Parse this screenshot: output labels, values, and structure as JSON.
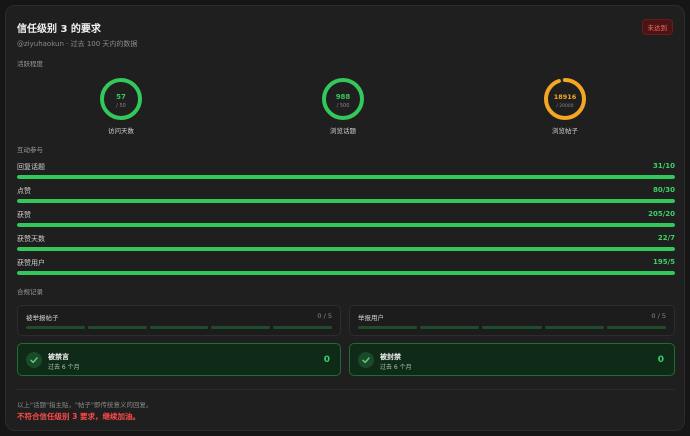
{
  "header": {
    "title": "信任级别 3 的要求",
    "badge": "未达到",
    "subtitle": "@ziyuhaokun · 过去 100 天内的数据"
  },
  "activity": {
    "section": "活跃程度",
    "rings": [
      {
        "value": "57",
        "total": "/ 50",
        "label": "访问天数",
        "progress": 1.0,
        "color": "#34c759"
      },
      {
        "value": "988",
        "total": "/ 500",
        "label": "浏览话题",
        "progress": 1.0,
        "color": "#34c759"
      },
      {
        "value": "18916",
        "total": "/ 20000",
        "label": "浏览帖子",
        "progress": 0.946,
        "color": "#f5a623"
      }
    ]
  },
  "interaction": {
    "section": "互动参与",
    "bars": [
      {
        "label": "回复话题",
        "value": "31/10",
        "progress": 1.0
      },
      {
        "label": "点赞",
        "value": "80/30",
        "progress": 1.0
      },
      {
        "label": "获赞",
        "value": "205/20",
        "progress": 1.0
      },
      {
        "label": "获赞天数",
        "value": "22/7",
        "progress": 1.0
      },
      {
        "label": "获赞用户",
        "value": "195/5",
        "progress": 1.0
      }
    ]
  },
  "compliance": {
    "section": "合规记录",
    "reports": [
      {
        "label": "被举报帖子",
        "value": "0 / 5"
      },
      {
        "label": "举报用户",
        "value": "0 / 5"
      }
    ],
    "status": [
      {
        "title": "被禁言",
        "sub": "过去 6 个月",
        "value": "0",
        "icon": "check-icon"
      },
      {
        "title": "被封禁",
        "sub": "过去 6 个月",
        "value": "0",
        "icon": "check-icon"
      }
    ]
  },
  "footer": {
    "note": "以上\"话题\"指主贴，\"帖子\"即传统意义的回复。",
    "result": "不符合信任级别 3 要求，继续加油。"
  }
}
